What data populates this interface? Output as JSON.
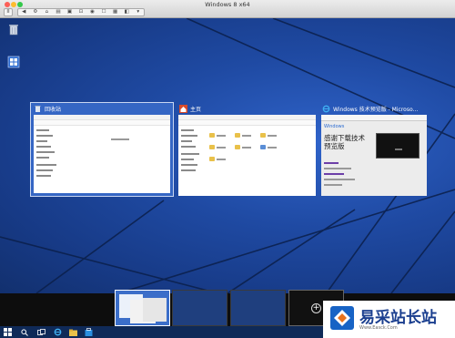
{
  "vm": {
    "title": "Windows 8 x64",
    "toolbar_pause": "II",
    "toolbar_icons": [
      "◀",
      "⚙",
      "⌂",
      "▤",
      "▣",
      "⊡",
      "◉",
      "☐",
      "▦",
      "◧",
      "▾"
    ]
  },
  "desktop": {
    "icons": [
      {
        "name": "recycle-bin-icon"
      },
      {
        "name": "shortcut-icon"
      }
    ]
  },
  "task_view": {
    "windows": [
      {
        "title": "回收站",
        "icon": "recycle-bin-icon",
        "selected": true
      },
      {
        "title": "主页",
        "icon": "home-folder-icon",
        "selected": false
      },
      {
        "title": "Windows 技术预览版 - Microso...",
        "icon": "ie-icon",
        "selected": false
      }
    ],
    "ie_page": {
      "brand": "Windows",
      "heading": "感谢下载技术预览版"
    },
    "add_desktop": "+"
  },
  "colors": {
    "desktop_blue": "#1f4aa3",
    "selected_window": "#3566c4",
    "watermark_blue": "#1b3f8f"
  },
  "watermark": {
    "text": "易采站长站",
    "sub": "Www.Easck.Com"
  }
}
